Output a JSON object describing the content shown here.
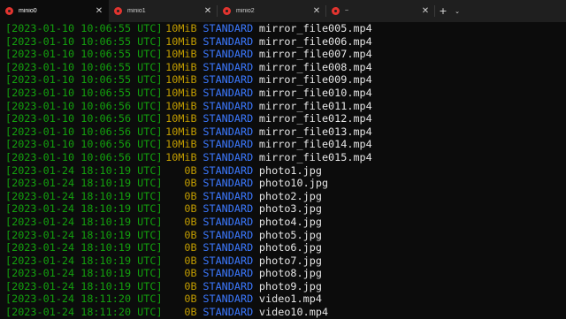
{
  "tabs": [
    {
      "title": "minio0",
      "active": true
    },
    {
      "title": "minio1",
      "active": false
    },
    {
      "title": "minio2",
      "active": false
    },
    {
      "title": "~",
      "active": false
    }
  ],
  "tab_controls": {
    "new_tab": "+",
    "dropdown": "⌄",
    "close": "✕"
  },
  "colors": {
    "timestamp": "#13a10e",
    "size": "#c19c00",
    "storage_class": "#3b78ff",
    "filename": "#e6e6e6",
    "background": "#0c0c0c",
    "tab_icon": "#e3342f"
  },
  "rows": [
    {
      "timestamp": "[2023-01-10 10:06:55 UTC]",
      "size": "10MiB",
      "class": "STANDARD",
      "name": "mirror_file005.mp4"
    },
    {
      "timestamp": "[2023-01-10 10:06:55 UTC]",
      "size": "10MiB",
      "class": "STANDARD",
      "name": "mirror_file006.mp4"
    },
    {
      "timestamp": "[2023-01-10 10:06:55 UTC]",
      "size": "10MiB",
      "class": "STANDARD",
      "name": "mirror_file007.mp4"
    },
    {
      "timestamp": "[2023-01-10 10:06:55 UTC]",
      "size": "10MiB",
      "class": "STANDARD",
      "name": "mirror_file008.mp4"
    },
    {
      "timestamp": "[2023-01-10 10:06:55 UTC]",
      "size": "10MiB",
      "class": "STANDARD",
      "name": "mirror_file009.mp4"
    },
    {
      "timestamp": "[2023-01-10 10:06:55 UTC]",
      "size": "10MiB",
      "class": "STANDARD",
      "name": "mirror_file010.mp4"
    },
    {
      "timestamp": "[2023-01-10 10:06:56 UTC]",
      "size": "10MiB",
      "class": "STANDARD",
      "name": "mirror_file011.mp4"
    },
    {
      "timestamp": "[2023-01-10 10:06:56 UTC]",
      "size": "10MiB",
      "class": "STANDARD",
      "name": "mirror_file012.mp4"
    },
    {
      "timestamp": "[2023-01-10 10:06:56 UTC]",
      "size": "10MiB",
      "class": "STANDARD",
      "name": "mirror_file013.mp4"
    },
    {
      "timestamp": "[2023-01-10 10:06:56 UTC]",
      "size": "10MiB",
      "class": "STANDARD",
      "name": "mirror_file014.mp4"
    },
    {
      "timestamp": "[2023-01-10 10:06:56 UTC]",
      "size": "10MiB",
      "class": "STANDARD",
      "name": "mirror_file015.mp4"
    },
    {
      "timestamp": "[2023-01-24 18:10:19 UTC]",
      "size": "0B",
      "class": "STANDARD",
      "name": "photo1.jpg"
    },
    {
      "timestamp": "[2023-01-24 18:10:19 UTC]",
      "size": "0B",
      "class": "STANDARD",
      "name": "photo10.jpg"
    },
    {
      "timestamp": "[2023-01-24 18:10:19 UTC]",
      "size": "0B",
      "class": "STANDARD",
      "name": "photo2.jpg"
    },
    {
      "timestamp": "[2023-01-24 18:10:19 UTC]",
      "size": "0B",
      "class": "STANDARD",
      "name": "photo3.jpg"
    },
    {
      "timestamp": "[2023-01-24 18:10:19 UTC]",
      "size": "0B",
      "class": "STANDARD",
      "name": "photo4.jpg"
    },
    {
      "timestamp": "[2023-01-24 18:10:19 UTC]",
      "size": "0B",
      "class": "STANDARD",
      "name": "photo5.jpg"
    },
    {
      "timestamp": "[2023-01-24 18:10:19 UTC]",
      "size": "0B",
      "class": "STANDARD",
      "name": "photo6.jpg"
    },
    {
      "timestamp": "[2023-01-24 18:10:19 UTC]",
      "size": "0B",
      "class": "STANDARD",
      "name": "photo7.jpg"
    },
    {
      "timestamp": "[2023-01-24 18:10:19 UTC]",
      "size": "0B",
      "class": "STANDARD",
      "name": "photo8.jpg"
    },
    {
      "timestamp": "[2023-01-24 18:10:19 UTC]",
      "size": "0B",
      "class": "STANDARD",
      "name": "photo9.jpg"
    },
    {
      "timestamp": "[2023-01-24 18:11:20 UTC]",
      "size": "0B",
      "class": "STANDARD",
      "name": "video1.mp4"
    },
    {
      "timestamp": "[2023-01-24 18:11:20 UTC]",
      "size": "0B",
      "class": "STANDARD",
      "name": "video10.mp4"
    }
  ]
}
